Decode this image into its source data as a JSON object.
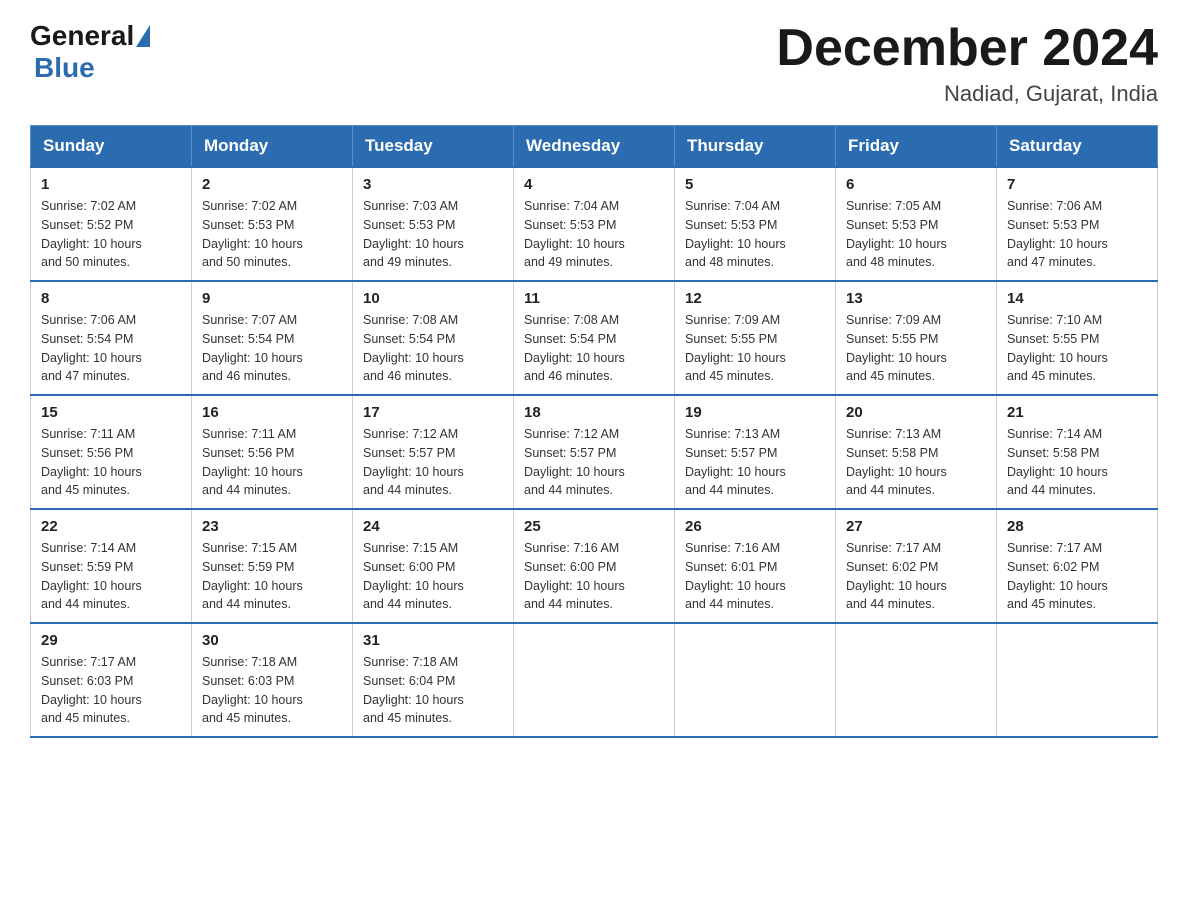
{
  "header": {
    "logo_general": "General",
    "logo_blue": "Blue",
    "month_title": "December 2024",
    "location": "Nadiad, Gujarat, India"
  },
  "days_of_week": [
    "Sunday",
    "Monday",
    "Tuesday",
    "Wednesday",
    "Thursday",
    "Friday",
    "Saturday"
  ],
  "weeks": [
    [
      {
        "day": "1",
        "sunrise": "7:02 AM",
        "sunset": "5:52 PM",
        "daylight": "10 hours and 50 minutes."
      },
      {
        "day": "2",
        "sunrise": "7:02 AM",
        "sunset": "5:53 PM",
        "daylight": "10 hours and 50 minutes."
      },
      {
        "day": "3",
        "sunrise": "7:03 AM",
        "sunset": "5:53 PM",
        "daylight": "10 hours and 49 minutes."
      },
      {
        "day": "4",
        "sunrise": "7:04 AM",
        "sunset": "5:53 PM",
        "daylight": "10 hours and 49 minutes."
      },
      {
        "day": "5",
        "sunrise": "7:04 AM",
        "sunset": "5:53 PM",
        "daylight": "10 hours and 48 minutes."
      },
      {
        "day": "6",
        "sunrise": "7:05 AM",
        "sunset": "5:53 PM",
        "daylight": "10 hours and 48 minutes."
      },
      {
        "day": "7",
        "sunrise": "7:06 AM",
        "sunset": "5:53 PM",
        "daylight": "10 hours and 47 minutes."
      }
    ],
    [
      {
        "day": "8",
        "sunrise": "7:06 AM",
        "sunset": "5:54 PM",
        "daylight": "10 hours and 47 minutes."
      },
      {
        "day": "9",
        "sunrise": "7:07 AM",
        "sunset": "5:54 PM",
        "daylight": "10 hours and 46 minutes."
      },
      {
        "day": "10",
        "sunrise": "7:08 AM",
        "sunset": "5:54 PM",
        "daylight": "10 hours and 46 minutes."
      },
      {
        "day": "11",
        "sunrise": "7:08 AM",
        "sunset": "5:54 PM",
        "daylight": "10 hours and 46 minutes."
      },
      {
        "day": "12",
        "sunrise": "7:09 AM",
        "sunset": "5:55 PM",
        "daylight": "10 hours and 45 minutes."
      },
      {
        "day": "13",
        "sunrise": "7:09 AM",
        "sunset": "5:55 PM",
        "daylight": "10 hours and 45 minutes."
      },
      {
        "day": "14",
        "sunrise": "7:10 AM",
        "sunset": "5:55 PM",
        "daylight": "10 hours and 45 minutes."
      }
    ],
    [
      {
        "day": "15",
        "sunrise": "7:11 AM",
        "sunset": "5:56 PM",
        "daylight": "10 hours and 45 minutes."
      },
      {
        "day": "16",
        "sunrise": "7:11 AM",
        "sunset": "5:56 PM",
        "daylight": "10 hours and 44 minutes."
      },
      {
        "day": "17",
        "sunrise": "7:12 AM",
        "sunset": "5:57 PM",
        "daylight": "10 hours and 44 minutes."
      },
      {
        "day": "18",
        "sunrise": "7:12 AM",
        "sunset": "5:57 PM",
        "daylight": "10 hours and 44 minutes."
      },
      {
        "day": "19",
        "sunrise": "7:13 AM",
        "sunset": "5:57 PM",
        "daylight": "10 hours and 44 minutes."
      },
      {
        "day": "20",
        "sunrise": "7:13 AM",
        "sunset": "5:58 PM",
        "daylight": "10 hours and 44 minutes."
      },
      {
        "day": "21",
        "sunrise": "7:14 AM",
        "sunset": "5:58 PM",
        "daylight": "10 hours and 44 minutes."
      }
    ],
    [
      {
        "day": "22",
        "sunrise": "7:14 AM",
        "sunset": "5:59 PM",
        "daylight": "10 hours and 44 minutes."
      },
      {
        "day": "23",
        "sunrise": "7:15 AM",
        "sunset": "5:59 PM",
        "daylight": "10 hours and 44 minutes."
      },
      {
        "day": "24",
        "sunrise": "7:15 AM",
        "sunset": "6:00 PM",
        "daylight": "10 hours and 44 minutes."
      },
      {
        "day": "25",
        "sunrise": "7:16 AM",
        "sunset": "6:00 PM",
        "daylight": "10 hours and 44 minutes."
      },
      {
        "day": "26",
        "sunrise": "7:16 AM",
        "sunset": "6:01 PM",
        "daylight": "10 hours and 44 minutes."
      },
      {
        "day": "27",
        "sunrise": "7:17 AM",
        "sunset": "6:02 PM",
        "daylight": "10 hours and 44 minutes."
      },
      {
        "day": "28",
        "sunrise": "7:17 AM",
        "sunset": "6:02 PM",
        "daylight": "10 hours and 45 minutes."
      }
    ],
    [
      {
        "day": "29",
        "sunrise": "7:17 AM",
        "sunset": "6:03 PM",
        "daylight": "10 hours and 45 minutes."
      },
      {
        "day": "30",
        "sunrise": "7:18 AM",
        "sunset": "6:03 PM",
        "daylight": "10 hours and 45 minutes."
      },
      {
        "day": "31",
        "sunrise": "7:18 AM",
        "sunset": "6:04 PM",
        "daylight": "10 hours and 45 minutes."
      },
      null,
      null,
      null,
      null
    ]
  ],
  "labels": {
    "sunrise": "Sunrise:",
    "sunset": "Sunset:",
    "daylight": "Daylight:"
  }
}
